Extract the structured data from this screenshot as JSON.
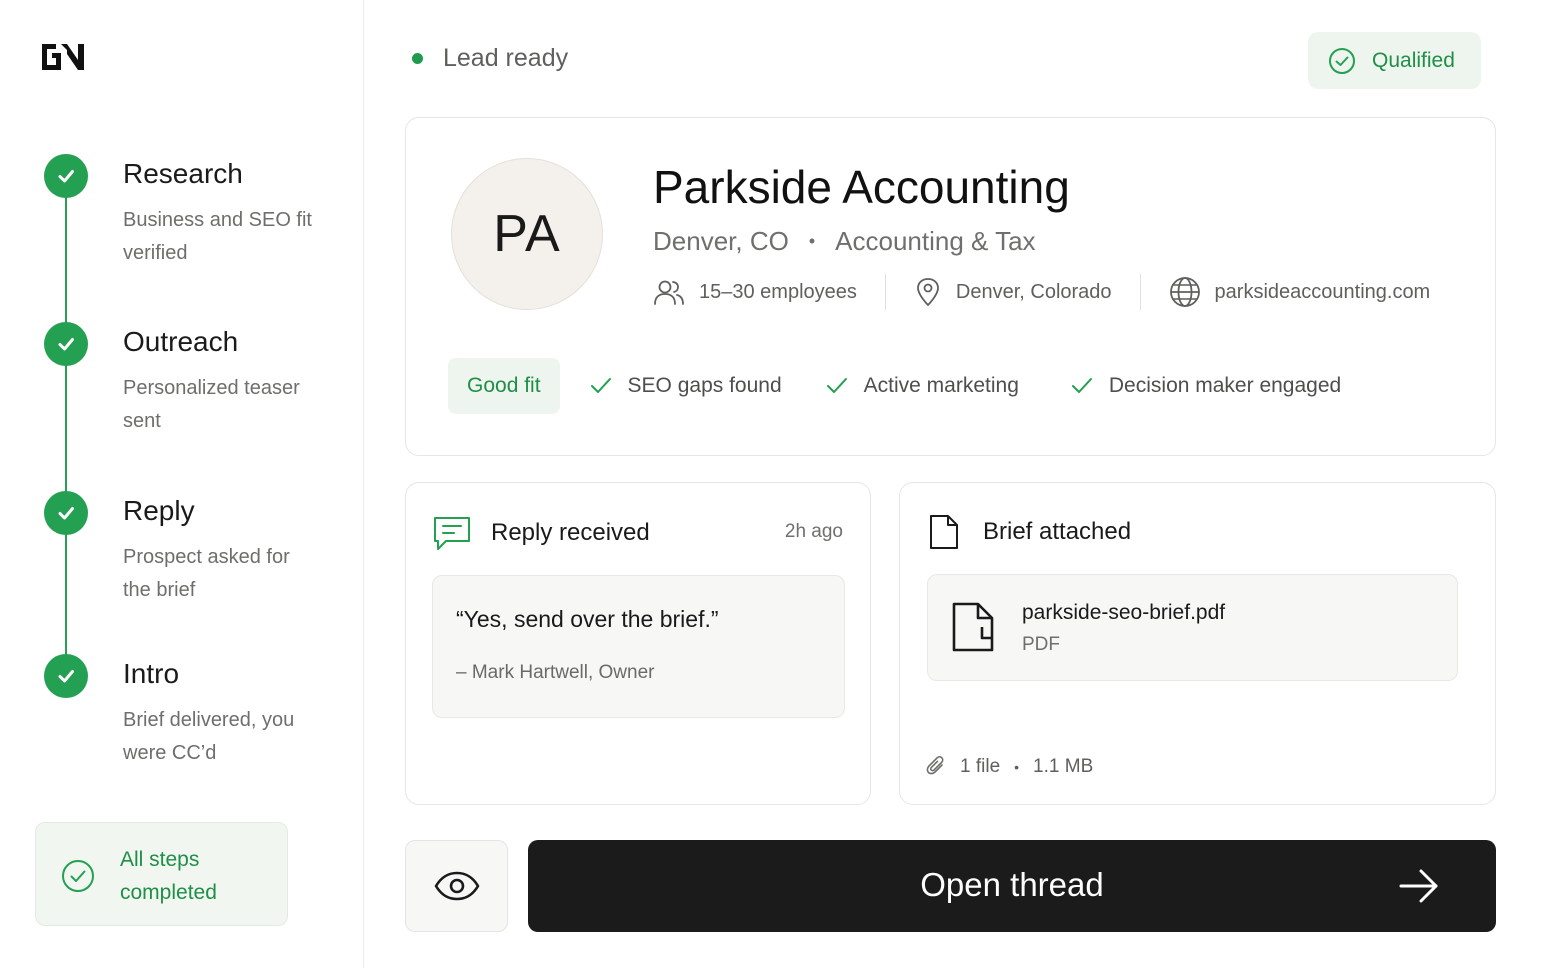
{
  "sidebar": {
    "steps": [
      {
        "title": "Research",
        "desc": "Business and SEO fit verified"
      },
      {
        "title": "Outreach",
        "desc": "Personalized teaser sent"
      },
      {
        "title": "Reply",
        "desc": "Prospect asked for the brief"
      },
      {
        "title": "Intro",
        "desc": "Brief delivered, you were CC’d"
      }
    ],
    "completion": "All steps completed"
  },
  "header": {
    "status": "Lead ready",
    "badge": "Qualified"
  },
  "lead": {
    "initials": "PA",
    "name": "Parkside Accounting",
    "city": "Denver, CO",
    "industry": "Accounting & Tax",
    "employees": "15–30 employees",
    "location": "Denver, Colorado",
    "website": "parksideaccounting.com",
    "fit_label": "Good fit",
    "signals": [
      "SEO gaps found",
      "Active marketing",
      "Decision maker engaged"
    ]
  },
  "reply": {
    "title": "Reply received",
    "time": "2h ago",
    "quote": "“Yes, send over the brief.”",
    "author": "– Mark Hartwell, Owner"
  },
  "brief": {
    "title": "Brief attached",
    "file_name": "parkside-seo-brief.pdf",
    "file_type": "PDF",
    "file_count": "1 file",
    "file_size": "1.1 MB"
  },
  "actions": {
    "open_label": "Open thread"
  },
  "colors": {
    "accent_green": "#23a052",
    "dark_button": "#1b1b1b"
  }
}
